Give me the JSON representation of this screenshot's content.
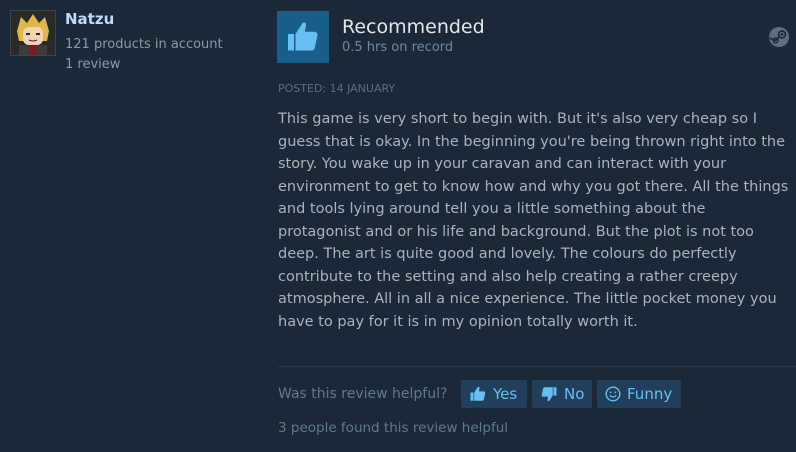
{
  "reviewer": {
    "name": "Natzu",
    "products": "121 products in account",
    "reviews": "1 review"
  },
  "review": {
    "verdict": "Recommended",
    "hours": "0.5 hrs on record",
    "posted": "POSTED: 14 JANUARY",
    "text": "This game is very short to begin with. But it's also very cheap so I guess that is okay. In the beginning you're being thrown right into the story. You wake up in your caravan and can interact with your environment to get to know how and why you got there. All the things and tools lying around tell you a little something about the protagonist and or his life and background. But the plot is not too deep. The art is quite good and lovely. The colours do perfectly contribute to the setting and also help creating a rather creepy atmosphere. All in all a nice experience. The little pocket money you have to pay for it is in my opinion totally worth it."
  },
  "helpful": {
    "question": "Was this review helpful?",
    "yes_label": "Yes",
    "no_label": "No",
    "funny_label": "Funny",
    "found_text": "3 people found this review helpful"
  },
  "icons": {
    "verdict": "thumbs-up-icon",
    "platform": "steam-icon",
    "yes": "thumbs-up-icon",
    "no": "thumbs-down-icon",
    "funny": "smiley-icon"
  },
  "colors": {
    "background": "#1b2838",
    "accent": "#66c0f4",
    "button_bg": "#213f5b",
    "thumb_box": "#1a5e8c",
    "username": "#c1dbf4"
  }
}
